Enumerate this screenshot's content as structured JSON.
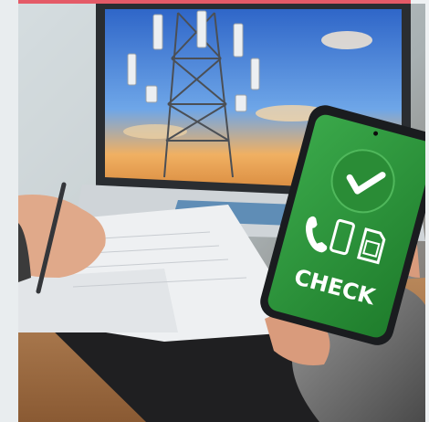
{
  "photo": {
    "alt": "",
    "phone_screen": {
      "label": "CHECK",
      "icons": [
        "checkmark-icon",
        "phone-handset-icon",
        "smartphone-icon",
        "sim-card-icon"
      ],
      "screen_color": "#2f9a3a"
    },
    "laptop_screen": {
      "subject_icon": "cell-tower-icon"
    },
    "accent_color": "#e45a67"
  }
}
